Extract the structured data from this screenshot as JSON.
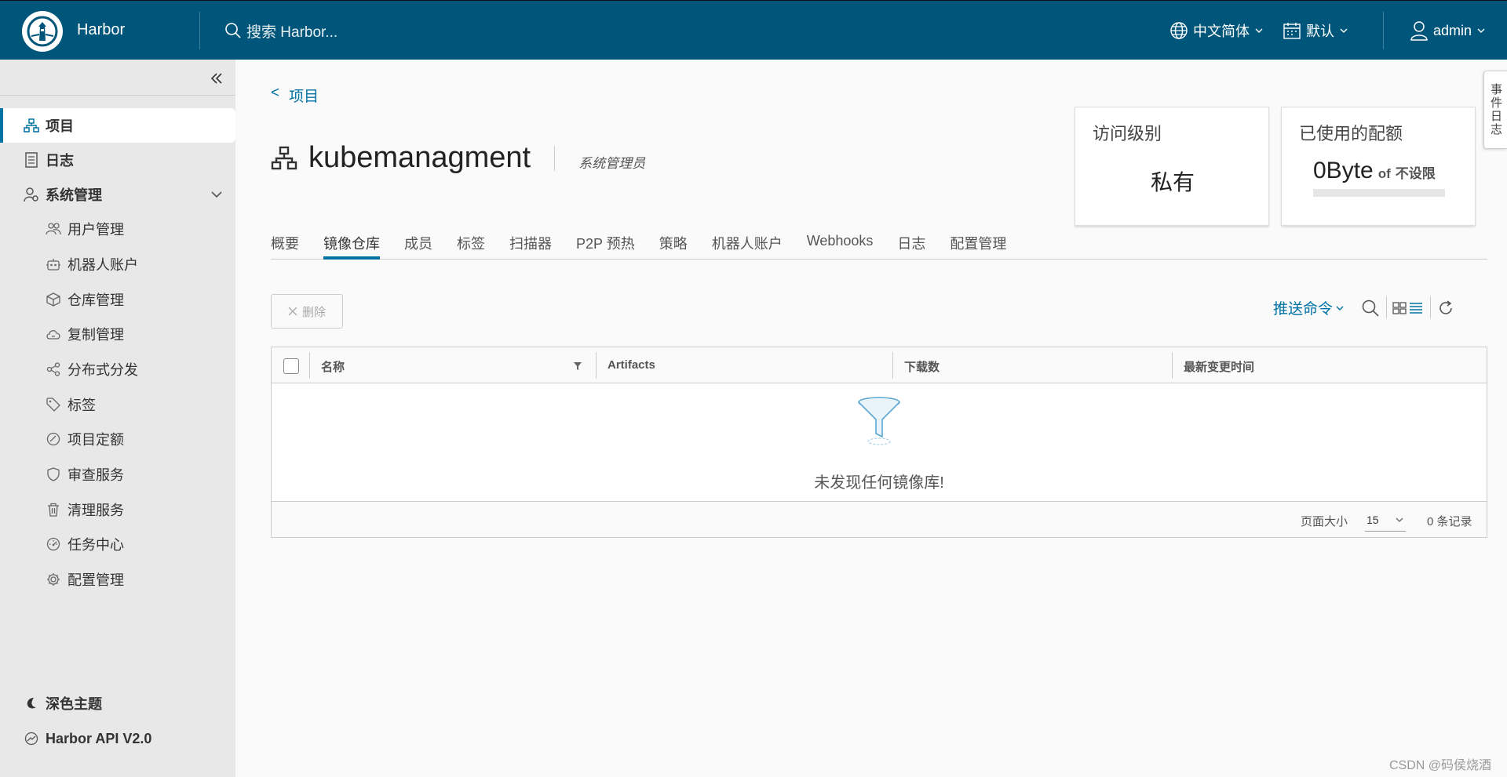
{
  "header": {
    "brand": "Harbor",
    "search_placeholder": "搜索 Harbor...",
    "language": "中文简体",
    "theme": "默认",
    "user": "admin"
  },
  "sidebar": {
    "items": [
      {
        "label": "项目",
        "icon": "project-icon"
      },
      {
        "label": "日志",
        "icon": "log-icon"
      },
      {
        "label": "系统管理",
        "icon": "admin-icon"
      }
    ],
    "sub_items": [
      {
        "label": "用户管理",
        "icon": "users-icon"
      },
      {
        "label": "机器人账户",
        "icon": "robot-icon"
      },
      {
        "label": "仓库管理",
        "icon": "registry-icon"
      },
      {
        "label": "复制管理",
        "icon": "replication-icon"
      },
      {
        "label": "分布式分发",
        "icon": "distribution-icon"
      },
      {
        "label": "标签",
        "icon": "tag-icon"
      },
      {
        "label": "项目定额",
        "icon": "quota-icon"
      },
      {
        "label": "审查服务",
        "icon": "shield-icon"
      },
      {
        "label": "清理服务",
        "icon": "trash-icon"
      },
      {
        "label": "任务中心",
        "icon": "dashboard-icon"
      },
      {
        "label": "配置管理",
        "icon": "gear-icon"
      }
    ],
    "bottom": [
      {
        "label": "深色主题",
        "icon": "moon-icon"
      },
      {
        "label": "Harbor API V2.0",
        "icon": "api-icon"
      }
    ]
  },
  "main": {
    "breadcrumb_back": "<",
    "breadcrumb": "项目",
    "project_name": "kubemanagment",
    "role": "系统管理员",
    "access_card": {
      "title": "访问级别",
      "value": "私有"
    },
    "quota_card": {
      "title": "已使用的配额",
      "used": "0Byte",
      "of": "of",
      "limit": "不设限",
      "used_fraction": 0
    },
    "tabs": [
      "概要",
      "镜像仓库",
      "成员",
      "标签",
      "扫描器",
      "P2P 预热",
      "策略",
      "机器人账户",
      "Webhooks",
      "日志",
      "配置管理"
    ],
    "active_tab": "镜像仓库",
    "delete_label": "删除",
    "push_command": "推送命令",
    "columns": [
      "名称",
      "Artifacts",
      "下载数",
      "最新变更时间"
    ],
    "empty_text": "未发现任何镜像库!",
    "page_size_label": "页面大小",
    "page_size": "15",
    "record_count": "0 条记录",
    "side_tab": "事件日志"
  },
  "watermark": "CSDN @码侯烧酒",
  "colors": {
    "header": "#00567a",
    "accent": "#0072a3"
  }
}
